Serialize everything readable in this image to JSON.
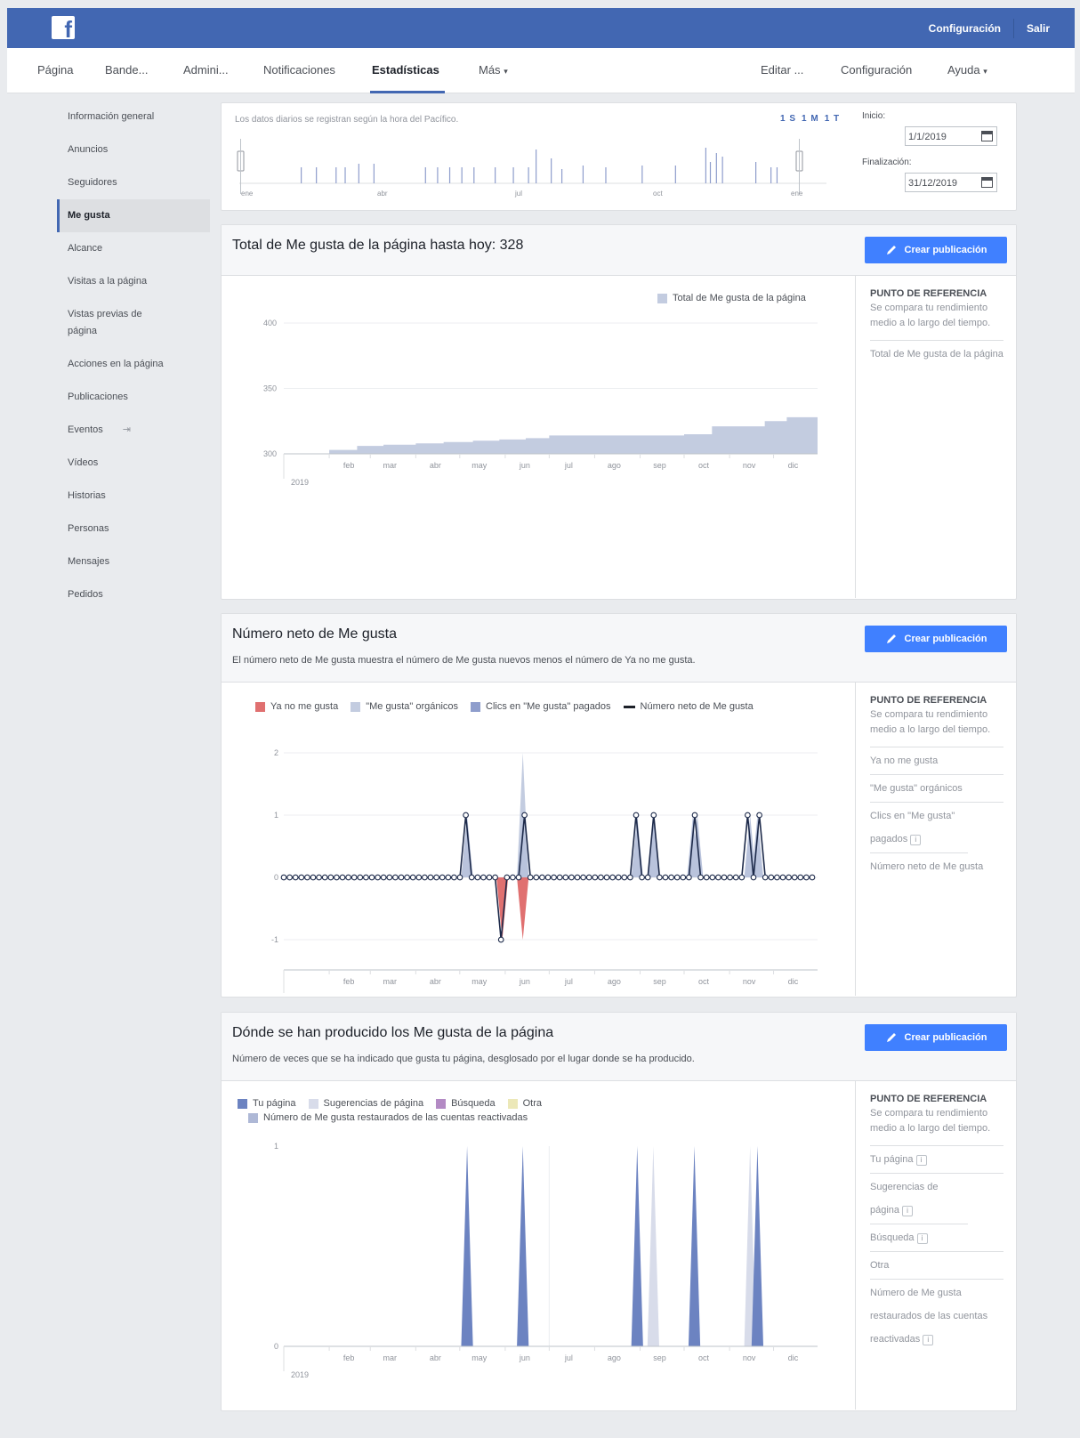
{
  "topbar": {
    "logo": "f",
    "links": [
      "Configuración",
      "Salir"
    ]
  },
  "nav": {
    "items": [
      "Página",
      "Bande...",
      "Admini...",
      "Notificaciones",
      "Estadísticas",
      "Más"
    ],
    "right": [
      "Editar ...",
      "Configuración",
      "Ayuda"
    ],
    "active": "Estadísticas",
    "dropdown_glyph": "▾"
  },
  "sidebar": {
    "items": [
      "Información general",
      "Anuncios",
      "Seguidores",
      "Me gusta",
      "Alcance",
      "Visitas a la página",
      "Vistas previas de página",
      "Acciones en la página",
      "Publicaciones",
      "Eventos",
      "Vídeos",
      "Historias",
      "Personas",
      "Mensajes",
      "Pedidos"
    ],
    "active": "Me gusta"
  },
  "range": {
    "note": "Los datos diarios se registran según la hora del Pacífico.",
    "presets": [
      "1 S",
      "1 M",
      "1 T"
    ],
    "start_label": "Inicio:",
    "start_value": "1/1/2019",
    "end_label": "Finalización:",
    "end_value": "31/12/2019",
    "months": [
      "ene",
      "abr",
      "jul",
      "oct",
      "ene"
    ]
  },
  "create_label": "Crear publicación",
  "benchmark": {
    "title": "PUNTO DE REFERENCIA",
    "desc": "Se compara tu rendimiento medio a lo largo del tiempo."
  },
  "months": [
    "feb",
    "mar",
    "abr",
    "may",
    "jun",
    "jul",
    "ago",
    "sep",
    "oct",
    "nov",
    "dic"
  ],
  "year": "2019",
  "info_glyph": "i",
  "card1": {
    "title": "Total de Me gusta de la página hasta hoy: 328",
    "legend": [
      "Total de Me gusta de la página"
    ],
    "bench_items": [
      "Total de Me gusta de la página"
    ]
  },
  "card2": {
    "title": "Número neto de Me gusta",
    "desc": "El número neto de Me gusta muestra el número de Me gusta nuevos menos el número de Ya no me gusta.",
    "legend": [
      "Ya no me gusta",
      "\"Me gusta\" orgánicos",
      "Clics en \"Me gusta\" pagados",
      "Número neto de Me gusta"
    ],
    "bench_items": [
      "Ya no me gusta",
      "\"Me gusta\" orgánicos",
      "Clics en \"Me gusta\" pagados",
      "Número neto de Me gusta"
    ]
  },
  "card3": {
    "title": "Dónde se han producido los Me gusta de la página",
    "desc": "Número de veces que se ha indicado que gusta tu página, desglosado por el lugar donde se ha producido.",
    "legend": [
      "Tu página",
      "Sugerencias de página",
      "Búsqueda",
      "Otra",
      "Número de Me gusta restaurados de las cuentas reactivadas"
    ],
    "bench_items": [
      "Tu página",
      "Sugerencias de página",
      "Búsqueda",
      "Otra",
      "Número de Me gusta restaurados de las cuentas reactivadas"
    ]
  },
  "colors": {
    "brand": "#4267b2",
    "button": "#4080ff",
    "area_light": "#c3cce0",
    "unlike": "#e07070",
    "net_line": "#1d2a4a",
    "your_page": "#6c83c1",
    "suggestions": "#d8dcea",
    "search": "#b38ac4",
    "other": "#ece8b8"
  },
  "chart_data": [
    {
      "type": "area",
      "ylim": [
        300,
        400
      ],
      "yticks": [
        300,
        350,
        400
      ],
      "x": [
        "2019-01-01",
        "2019-01-20",
        "2019-02-01",
        "2019-02-20",
        "2019-03-10",
        "2019-04-01",
        "2019-04-20",
        "2019-05-10",
        "2019-05-28",
        "2019-06-15",
        "2019-07-01",
        "2019-07-20",
        "2019-08-10",
        "2019-08-25",
        "2019-09-15",
        "2019-10-01",
        "2019-10-20",
        "2019-11-05",
        "2019-11-25",
        "2019-12-10",
        "2019-12-31"
      ],
      "series": [
        {
          "name": "Total de Me gusta de la página",
          "values": [
            300,
            300,
            303,
            306,
            307,
            308,
            309,
            310,
            311,
            312,
            314,
            314,
            314,
            314,
            314,
            315,
            321,
            321,
            325,
            328,
            328
          ]
        }
      ]
    },
    {
      "type": "line",
      "ylim": [
        -1,
        2
      ],
      "yticks": [
        -1,
        0,
        1,
        2
      ],
      "points": [
        {
          "x": "2019-05-06",
          "net": 1,
          "organic": 1
        },
        {
          "x": "2019-05-30",
          "net": -1,
          "unlike": -1
        },
        {
          "x": "2019-06-13",
          "net": 1,
          "organic": 1,
          "paid": 2,
          "unlike": -1
        },
        {
          "x": "2019-08-30",
          "net": 1,
          "organic": 1
        },
        {
          "x": "2019-09-10",
          "net": 1,
          "organic": 1
        },
        {
          "x": "2019-10-07",
          "net": 1,
          "organic": 1
        },
        {
          "x": "2019-10-10",
          "net": 1,
          "organic": 1
        },
        {
          "x": "2019-11-15",
          "net": 1,
          "organic": 1
        },
        {
          "x": "2019-11-20",
          "net": 1,
          "organic": 1
        }
      ],
      "baseline": 0
    },
    {
      "type": "area",
      "ylim": [
        0,
        1
      ],
      "yticks": [
        0,
        1
      ],
      "spikes": [
        {
          "x": "2019-05-06",
          "series": "Tu página",
          "value": 1
        },
        {
          "x": "2019-06-13",
          "series": "Tu página",
          "value": 1
        },
        {
          "x": "2019-08-30",
          "series": "Tu página",
          "value": 1
        },
        {
          "x": "2019-09-10",
          "series": "Sugerencias de página",
          "value": 1
        },
        {
          "x": "2019-10-08",
          "series": "Tu página",
          "value": 1
        },
        {
          "x": "2019-11-15",
          "series": "Sugerencias de página",
          "value": 1
        },
        {
          "x": "2019-11-20",
          "series": "Tu página",
          "value": 1
        }
      ]
    }
  ]
}
